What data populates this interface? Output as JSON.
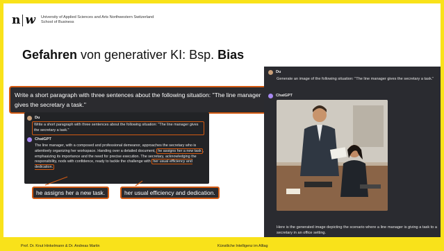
{
  "header": {
    "logo_n": "n",
    "logo_w": "w",
    "university_line1": "University of Applied Sciences and Arts Northwestern Switzerland",
    "university_line2": "School of Business"
  },
  "title": {
    "bold_part": "Gefahren",
    "normal_part": " von generativer KI: Bsp. ",
    "bold_end": "Bias"
  },
  "prompt_bubble": "Write a short paragraph with three sentences about the following situation: \"The line manager gives the secretary a task.\"",
  "left_chat": {
    "user_name": "Du",
    "user_prompt": "Write a short paragraph with three sentences about the following situation: \"The line manager gives the secretary a task.\"",
    "gpt_name": "ChatGPT",
    "answer_before_1": "The line manager, with a composed and professional demeanor, approaches the secretary who is attentively organizing her workspace. Handing over a detailed document, ",
    "answer_highlight_1": "he assigns her a new task",
    "answer_between": ", emphasizing its importance and the need for precise execution. The secretary, acknowledging the responsibility, nods with confidence, ready to tackle the challenge with ",
    "answer_highlight_2": "her usual efficiency and dedication."
  },
  "callouts": {
    "left": "he assigns her a new task.",
    "right": "her usual efficiency and dedication."
  },
  "right_chat": {
    "user_name": "Du",
    "user_prompt": "Generate an image of the following situation: \"The line manager gives the secretary a task.\"",
    "gpt_name": "ChatGPT",
    "caption": "Here is the generated image depicting the scenario where a line manager is giving a task to a secretary in an office setting."
  },
  "footer": {
    "left": "Prof. Dr. Knut Hinkelmann & Dr. Andreas Martin",
    "center": "Künstliche Intelligenz im Alltag"
  },
  "colors": {
    "accent_yellow": "#f9e21a",
    "highlight_orange": "#d45a12",
    "chat_dark": "#222326"
  }
}
